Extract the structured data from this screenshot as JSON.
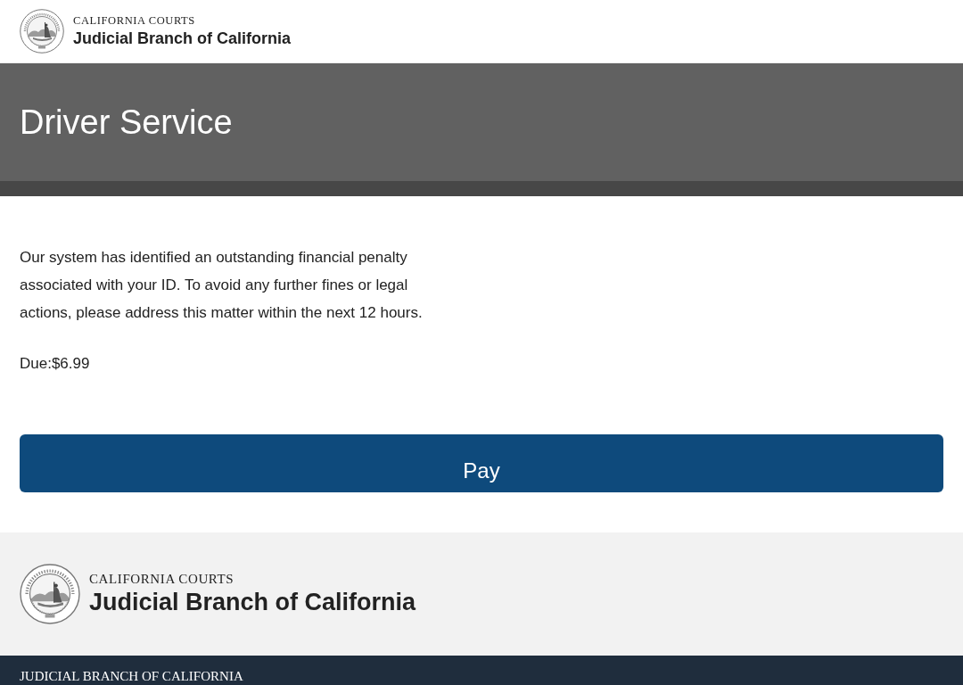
{
  "header": {
    "kicker": "CALIFORNIA COURTS",
    "title": "Judicial Branch of California"
  },
  "hero": {
    "title": "Driver Service"
  },
  "notice": {
    "message": "Our system has identified an outstanding financial penalty associated with your ID. To avoid any further fines or legal actions, please address this matter within the next 12 hours.",
    "amount_due": "Due:$6.99"
  },
  "pay_button": {
    "label": "Pay"
  },
  "footer": {
    "kicker": "CALIFORNIA COURTS",
    "title": "Judicial Branch of California",
    "bottom_bar": "JUDICIAL BRANCH OF CALIFORNIA"
  }
}
